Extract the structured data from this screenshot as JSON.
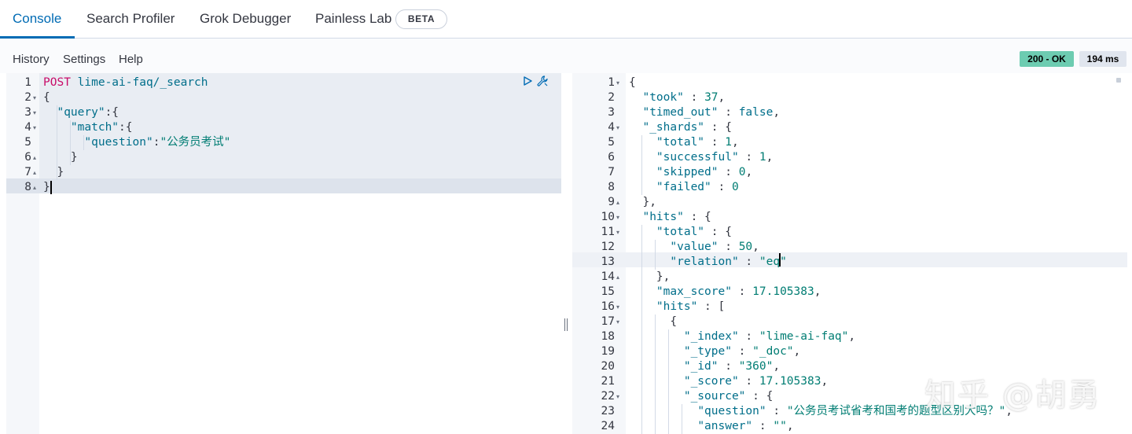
{
  "tabs": [
    {
      "label": "Console",
      "active": true
    },
    {
      "label": "Search Profiler"
    },
    {
      "label": "Grok Debugger"
    },
    {
      "label": "Painless Lab"
    }
  ],
  "beta_badge": "BETA",
  "toolbar": {
    "history": "History",
    "settings": "Settings",
    "help": "Help"
  },
  "status": {
    "code": "200 - OK",
    "time": "194 ms"
  },
  "request": {
    "method": "POST",
    "url": "lime-ai-faq/_search",
    "line_numbers": [
      "1",
      "2",
      "3",
      "4",
      "5",
      "6",
      "7",
      "8"
    ],
    "lines": [
      "",
      "{",
      "  \"query\":{",
      "    \"match\":{",
      "      \"question\":\"公务员考试\"",
      "    }",
      "  }",
      "}"
    ]
  },
  "response": {
    "line_numbers": [
      "1",
      "2",
      "3",
      "4",
      "5",
      "6",
      "7",
      "8",
      "9",
      "10",
      "11",
      "12",
      "13",
      "14",
      "15",
      "16",
      "17",
      "18",
      "19",
      "20",
      "21",
      "22",
      "23",
      "24"
    ],
    "lines": [
      "{",
      "  \"took\" : 37,",
      "  \"timed_out\" : false,",
      "  \"_shards\" : {",
      "    \"total\" : 1,",
      "    \"successful\" : 1,",
      "    \"skipped\" : 0,",
      "    \"failed\" : 0",
      "  },",
      "  \"hits\" : {",
      "    \"total\" : {",
      "      \"value\" : 50,",
      "      \"relation\" : \"eq\"",
      "    },",
      "    \"max_score\" : 17.105383,",
      "    \"hits\" : [",
      "      {",
      "        \"_index\" : \"lime-ai-faq\",",
      "        \"_type\" : \"_doc\",",
      "        \"_id\" : \"360\",",
      "        \"_score\" : 17.105383,",
      "        \"_source\" : {",
      "          \"question\" : \"公务员考试省考和国考的题型区别大吗？\",",
      "          \"answer\" : \"\","
    ]
  },
  "watermark": "知乎 @胡勇",
  "icons": [
    "play-icon",
    "wrench-icon",
    "fold-arrow-icon"
  ],
  "colors": {
    "accent": "#006bb4",
    "status_ok": "#6dccb1",
    "keyword": "#c80a68",
    "string": "#017d73",
    "key": "#006e8a"
  }
}
